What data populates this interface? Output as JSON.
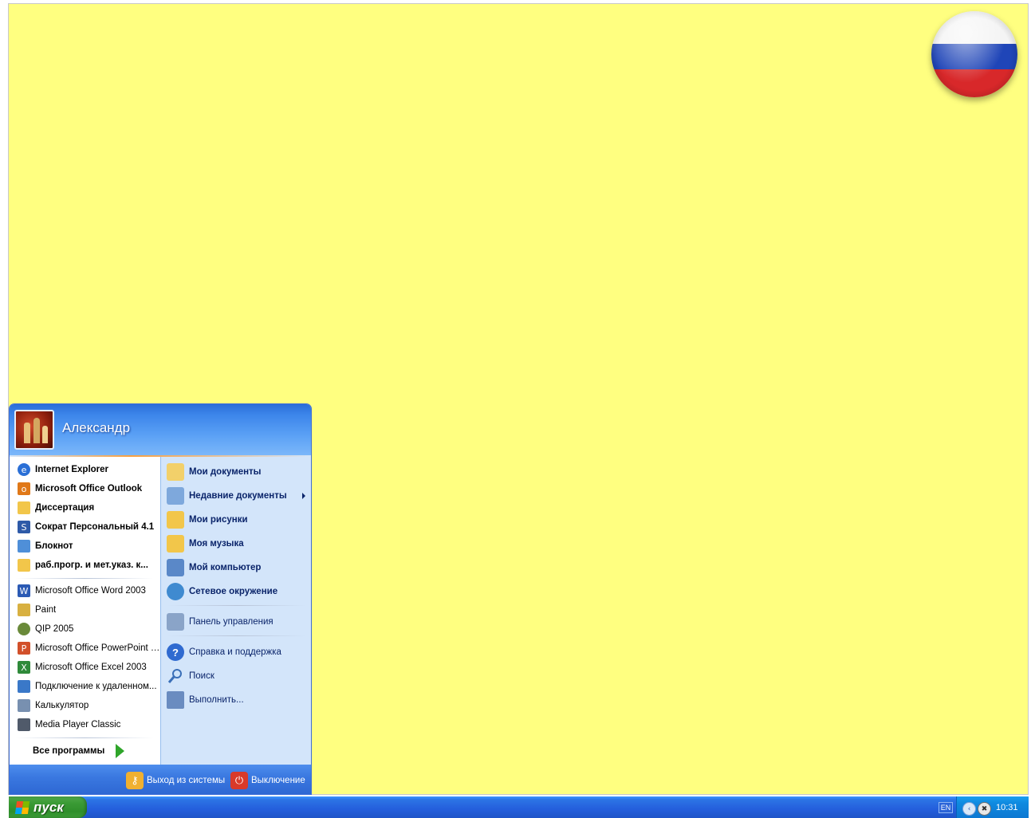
{
  "start_menu": {
    "user_name": "Александр",
    "pinned": [
      {
        "label": "Internet Explorer",
        "icon": "internet-explorer-icon"
      },
      {
        "label": "Microsoft Office Outlook",
        "icon": "outlook-icon"
      },
      {
        "label": "Диссертация",
        "icon": "folder-icon"
      },
      {
        "label": "Сократ Персональный 4.1",
        "icon": "socrat-icon"
      },
      {
        "label": "Блокнот",
        "icon": "notepad-icon"
      },
      {
        "label": "раб.прогр. и мет.указ. к...",
        "icon": "folder-icon"
      }
    ],
    "recent": [
      {
        "label": "Microsoft Office Word 2003",
        "icon": "word-icon"
      },
      {
        "label": "Paint",
        "icon": "paint-icon"
      },
      {
        "label": "QIP 2005",
        "icon": "qip-icon"
      },
      {
        "label": "Microsoft Office PowerPoint 2...",
        "icon": "powerpoint-icon"
      },
      {
        "label": "Microsoft Office Excel 2003",
        "icon": "excel-icon"
      },
      {
        "label": "Подключение к удаленном...",
        "icon": "remote-desktop-icon"
      },
      {
        "label": "Калькулятор",
        "icon": "calculator-icon"
      },
      {
        "label": "Media Player Classic",
        "icon": "media-player-icon"
      }
    ],
    "all_programs": "Все программы",
    "places": [
      {
        "label": "Мои документы",
        "icon": "my-documents-icon",
        "bold": true
      },
      {
        "label": "Недавние документы",
        "icon": "recent-documents-icon",
        "bold": true,
        "submenu": true
      },
      {
        "label": "Мои рисунки",
        "icon": "my-pictures-icon",
        "bold": true
      },
      {
        "label": "Моя музыка",
        "icon": "my-music-icon",
        "bold": true
      },
      {
        "label": "Мой компьютер",
        "icon": "my-computer-icon",
        "bold": true
      },
      {
        "label": "Сетевое окружение",
        "icon": "network-places-icon",
        "bold": true
      },
      {
        "label": "Панель управления",
        "icon": "control-panel-icon",
        "bold": false
      },
      {
        "label": "Справка и поддержка",
        "icon": "help-icon",
        "bold": false
      },
      {
        "label": "Поиск",
        "icon": "search-icon",
        "bold": false
      },
      {
        "label": "Выполнить...",
        "icon": "run-icon",
        "bold": false
      }
    ],
    "logoff": "Выход из системы",
    "shutdown": "Выключение"
  },
  "taskbar": {
    "start_label": "пуск",
    "language": "EN",
    "clock": "10:31"
  },
  "colors": {
    "desktop": "#ffff80",
    "taskbar": "#245edc",
    "start_button": "#3b9b35"
  }
}
